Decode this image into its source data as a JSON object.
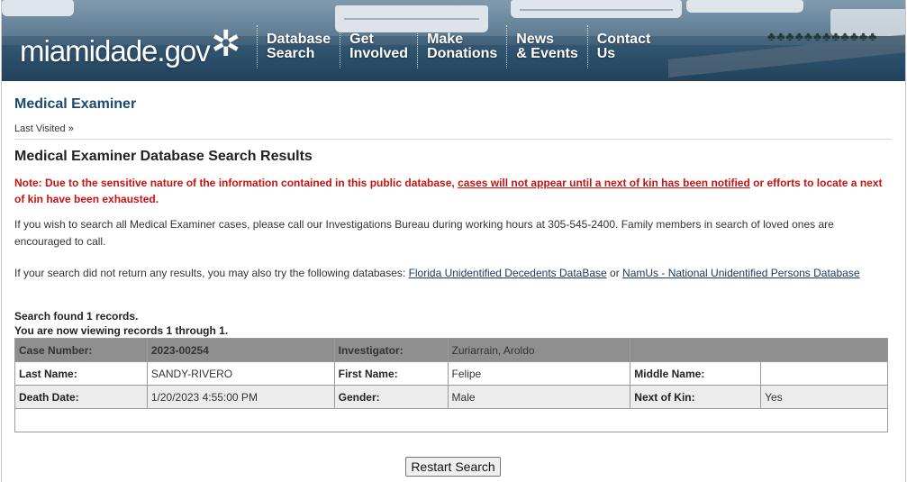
{
  "header": {
    "logo_text": "miamidade.gov",
    "nav": [
      {
        "line1": "Database",
        "line2": "Search"
      },
      {
        "line1": "Get",
        "line2": "Involved"
      },
      {
        "line1": "Make",
        "line2": "Donations"
      },
      {
        "line1": "News",
        "line2": "& Events"
      },
      {
        "line1": "Contact",
        "line2": "Us"
      }
    ]
  },
  "page": {
    "title": "Medical Examiner",
    "breadcrumb": "Last Visited »",
    "results_title": "Medical Examiner Database Search Results",
    "note_prefix": "Note: Due to the sensitive nature of the information contained in this public database, ",
    "note_link": "cases will not appear until a next of kin has been notified",
    "note_suffix": " or efforts to locate a next of kin have been exhausted.",
    "para1": "If you wish to search all Medical Examiner cases, please call our Investigations Bureau during working hours at 305-545-2400. Family members in search of loved ones are encouraged to call.",
    "para2_prefix": "If your search did not return any results, you may also try the following databases: ",
    "para2_link1": "Florida Unidentified Decedents DataBase",
    "para2_or": " or ",
    "para2_link2": "NamUs - National Unidentified Persons Database",
    "summary_line1": "Search found 1 records.",
    "summary_line2": "You are now viewing records 1 through 1."
  },
  "record": {
    "case_number_label": "Case Number:",
    "case_number": "2023-00254",
    "investigator_label": "Investigator:",
    "investigator": "Zuriarrain, Aroldo",
    "last_name_label": "Last Name:",
    "last_name": "SANDY-RIVERO",
    "first_name_label": "First Name:",
    "first_name": "Felipe",
    "middle_name_label": "Middle Name:",
    "middle_name": "",
    "death_date_label": "Death Date:",
    "death_date": "1/20/2023 4:55:00 PM",
    "gender_label": "Gender:",
    "gender": "Male",
    "next_of_kin_label": "Next of Kin:",
    "next_of_kin": "Yes"
  },
  "buttons": {
    "restart": "Restart Search"
  }
}
